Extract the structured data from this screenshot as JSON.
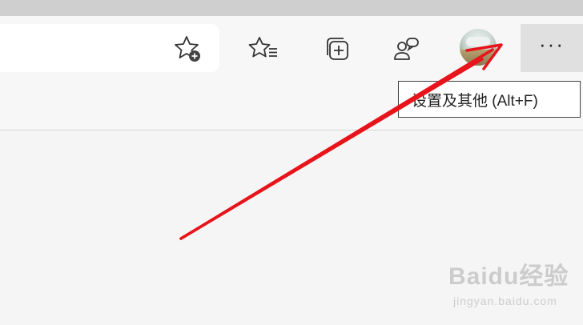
{
  "toolbar": {
    "favorite_add_icon": "star-plus-icon",
    "favorites_icon": "favorites-list-icon",
    "collections_icon": "collections-add-icon",
    "feedback_icon": "people-icon",
    "profile_icon": "avatar",
    "more_icon": "ellipsis-icon",
    "more_label": "···"
  },
  "tooltip": {
    "text": "设置及其他 (Alt+F)"
  },
  "annotation": {
    "color": "#e8141b"
  },
  "watermark": {
    "logo": "Baidu经验",
    "url": "jingyan.baidu.com"
  }
}
